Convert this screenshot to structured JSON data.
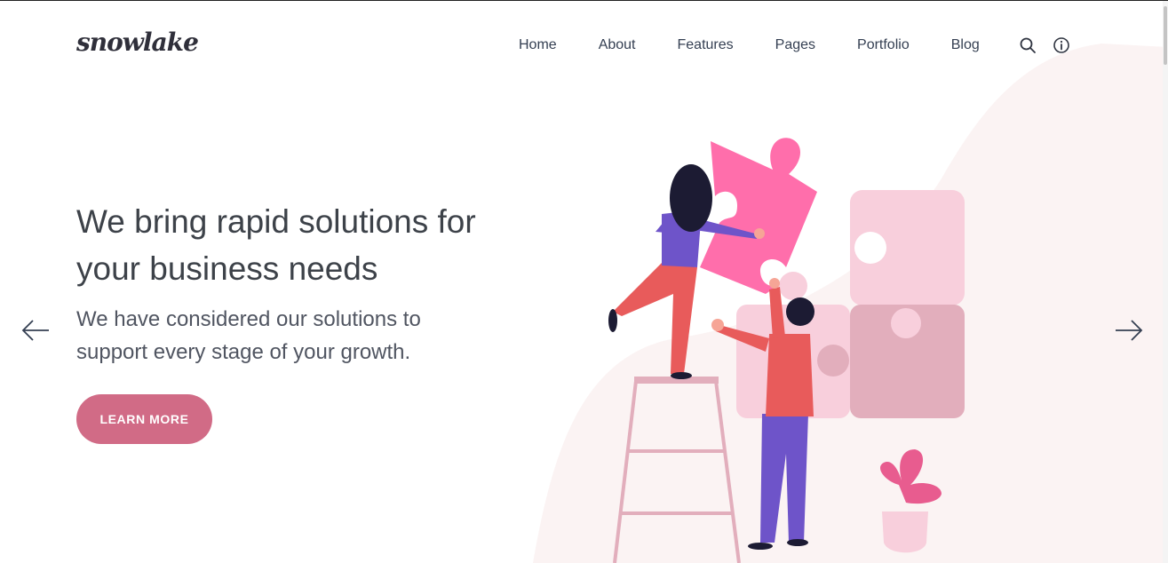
{
  "brand": {
    "logo_text": "snowlake"
  },
  "nav": {
    "items": [
      "Home",
      "About",
      "Features",
      "Pages",
      "Portfolio",
      "Blog"
    ],
    "search_icon": "search-icon",
    "info_icon": "info-icon"
  },
  "hero": {
    "headline": "We bring rapid solutions for your business needs",
    "subtext": "We have considered our solutions to support every stage of your growth.",
    "cta_label": "LEARN MORE",
    "prev_icon": "arrow-left-icon",
    "next_icon": "arrow-right-icon"
  },
  "colors": {
    "accent": "#d16b86",
    "blob": "#fbf3f3",
    "puzzle_pink": "#ff6eab",
    "puzzle_light": "#f8cfdc",
    "text": "#343f52"
  }
}
